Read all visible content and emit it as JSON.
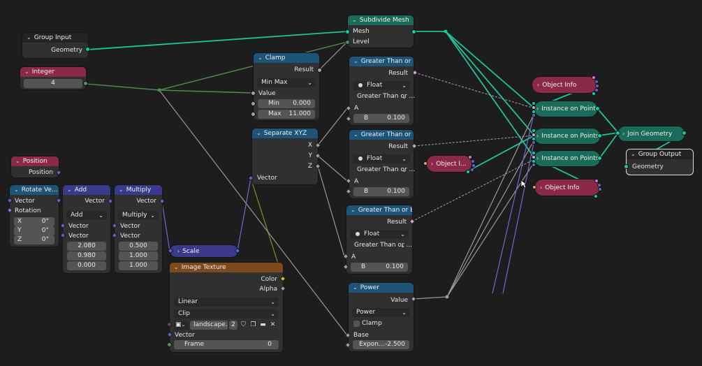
{
  "nodes": {
    "group_input": {
      "title": "Group Input",
      "geometry": "Geometry"
    },
    "integer": {
      "title": "Integer",
      "value": "4"
    },
    "position": {
      "title": "Position",
      "output": "Position"
    },
    "rotate_vector": {
      "title": "Rotate Ve...",
      "vector": "Vector",
      "rotation": "Rotation",
      "x_label": "X",
      "x": "0°",
      "y_label": "Y",
      "y": "0°",
      "z_label": "Z",
      "z": "0°"
    },
    "add": {
      "title": "Add",
      "out": "Vector",
      "op": "Add",
      "in1": "Vector",
      "in2": "Vector",
      "v1": "2.080",
      "v2": "0.980",
      "v3": "0.000"
    },
    "multiply": {
      "title": "Multiply",
      "out": "Vector",
      "op": "Multiply",
      "in1": "Vector",
      "in2": "Vector",
      "v1": "0.500",
      "v2": "1.000",
      "v3": "1.000"
    },
    "scale": {
      "title": "Scale"
    },
    "clamp": {
      "title": "Clamp",
      "result": "Result",
      "mode": "Min Max",
      "value": "Value",
      "min_label": "Min",
      "min": "0.000",
      "max_label": "Max",
      "max": "11.000"
    },
    "separate_xyz": {
      "title": "Separate XYZ",
      "x": "X",
      "y": "Y",
      "z": "Z",
      "vector": "Vector"
    },
    "image_texture": {
      "title": "Image Texture",
      "color": "Color",
      "alpha": "Alpha",
      "interp": "Linear",
      "ext": "Clip",
      "image": "landscape....",
      "users": "2",
      "vector": "Vector",
      "frame_label": "Frame",
      "frame": "0"
    },
    "subdivide_mesh": {
      "title": "Subdivide Mesh",
      "mesh": "Mesh",
      "level": "Level"
    },
    "gt1": {
      "title": "Greater Than or E...",
      "result": "Result",
      "type": "Float",
      "op": "Greater Than or ...",
      "a": "A",
      "b_label": "B",
      "b": "0.100"
    },
    "gt2": {
      "title": "Greater Than or E...",
      "result": "Result",
      "type": "Float",
      "op": "Greater Than or ...",
      "a": "A",
      "b_label": "B",
      "b": "0.100"
    },
    "gt3": {
      "title": "Greater Than or E...",
      "result": "Result",
      "type": "Float",
      "op": "Greater Than or ...",
      "a": "A",
      "b_label": "B",
      "b": "0.100"
    },
    "power": {
      "title": "Power",
      "value": "Value",
      "op": "Power",
      "clamp": "Clamp",
      "base": "Base",
      "exp_label": "Expon...",
      "exp": "-2.500"
    },
    "object_info_1": {
      "title": "Object Info"
    },
    "object_info_2": {
      "title": "Object I..."
    },
    "object_info_3": {
      "title": "Object Info"
    },
    "iop1": {
      "title": "Instance on Points"
    },
    "iop2": {
      "title": "Instance on Points"
    },
    "iop3": {
      "title": "Instance on Points"
    },
    "join_geometry": {
      "title": "Join Geometry"
    },
    "group_output": {
      "title": "Group Output",
      "geometry": "Geometry"
    }
  },
  "colors": {
    "geometry": "#00d6a3",
    "float": "#a1a1a1",
    "vector": "#6363c7",
    "boolean": "#cca6d6",
    "integer": "#598c5c",
    "color": "#c7c729",
    "object": "#ed9e5c",
    "link_int": "#4a8a4a",
    "link_vector": "#6c6cd0"
  },
  "icons": [
    "chevron-down-icon",
    "chevron-right-icon",
    "image-icon",
    "shield-icon",
    "copy-icon",
    "folder-icon",
    "close-icon",
    "checkbox-icon"
  ]
}
